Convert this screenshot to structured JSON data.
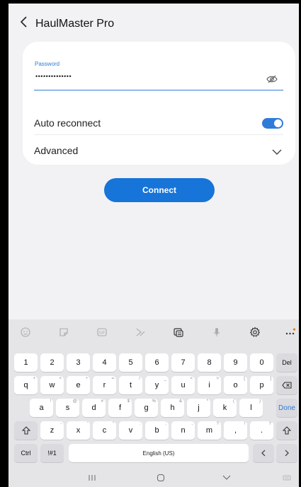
{
  "header": {
    "title": "HaulMaster Pro"
  },
  "password": {
    "label": "Password",
    "value": "••••••••••••••"
  },
  "auto_reconnect": {
    "label": "Auto reconnect",
    "enabled": true
  },
  "advanced": {
    "label": "Advanced"
  },
  "connect_label": "Connect",
  "keyboard": {
    "toolbar_icons": [
      "emoji-icon",
      "sticker-icon",
      "gif-icon",
      "handwriting-icon",
      "clipboard-icon",
      "microphone-icon",
      "settings-icon",
      "more-icon"
    ],
    "row_numbers": [
      "1",
      "2",
      "3",
      "4",
      "5",
      "6",
      "7",
      "8",
      "9",
      "0"
    ],
    "del_label": "Del",
    "row_top": [
      {
        "k": "q",
        "s": "+"
      },
      {
        "k": "w",
        "s": "×"
      },
      {
        "k": "e",
        "s": "÷"
      },
      {
        "k": "r",
        "s": "="
      },
      {
        "k": "t",
        "s": "/"
      },
      {
        "k": "y",
        "s": "_"
      },
      {
        "k": "u",
        "s": "<"
      },
      {
        "k": "i",
        "s": ">"
      },
      {
        "k": "o",
        "s": "["
      },
      {
        "k": "p",
        "s": "]"
      }
    ],
    "row_mid": [
      {
        "k": "a",
        "s": "!"
      },
      {
        "k": "s",
        "s": "@"
      },
      {
        "k": "d",
        "s": "#"
      },
      {
        "k": "f",
        "s": "$"
      },
      {
        "k": "g",
        "s": "%"
      },
      {
        "k": "h",
        "s": "&"
      },
      {
        "k": "j",
        "s": "*"
      },
      {
        "k": "k",
        "s": "("
      },
      {
        "k": "l",
        "s": ")"
      }
    ],
    "done_label": "Done",
    "row_bot": [
      {
        "k": "z",
        "s": "-"
      },
      {
        "k": "x",
        "s": "'"
      },
      {
        "k": "c",
        "s": "\""
      },
      {
        "k": "v",
        "s": ":"
      },
      {
        "k": "b",
        "s": ";"
      },
      {
        "k": "n",
        "s": ","
      },
      {
        "k": "m",
        "s": "?"
      },
      {
        "k": ",",
        "s": "!"
      },
      {
        "k": ".",
        "s": "?"
      }
    ],
    "ctrl_label": "Ctrl",
    "symbols_label": "!#1",
    "space_label": "English (US)"
  }
}
